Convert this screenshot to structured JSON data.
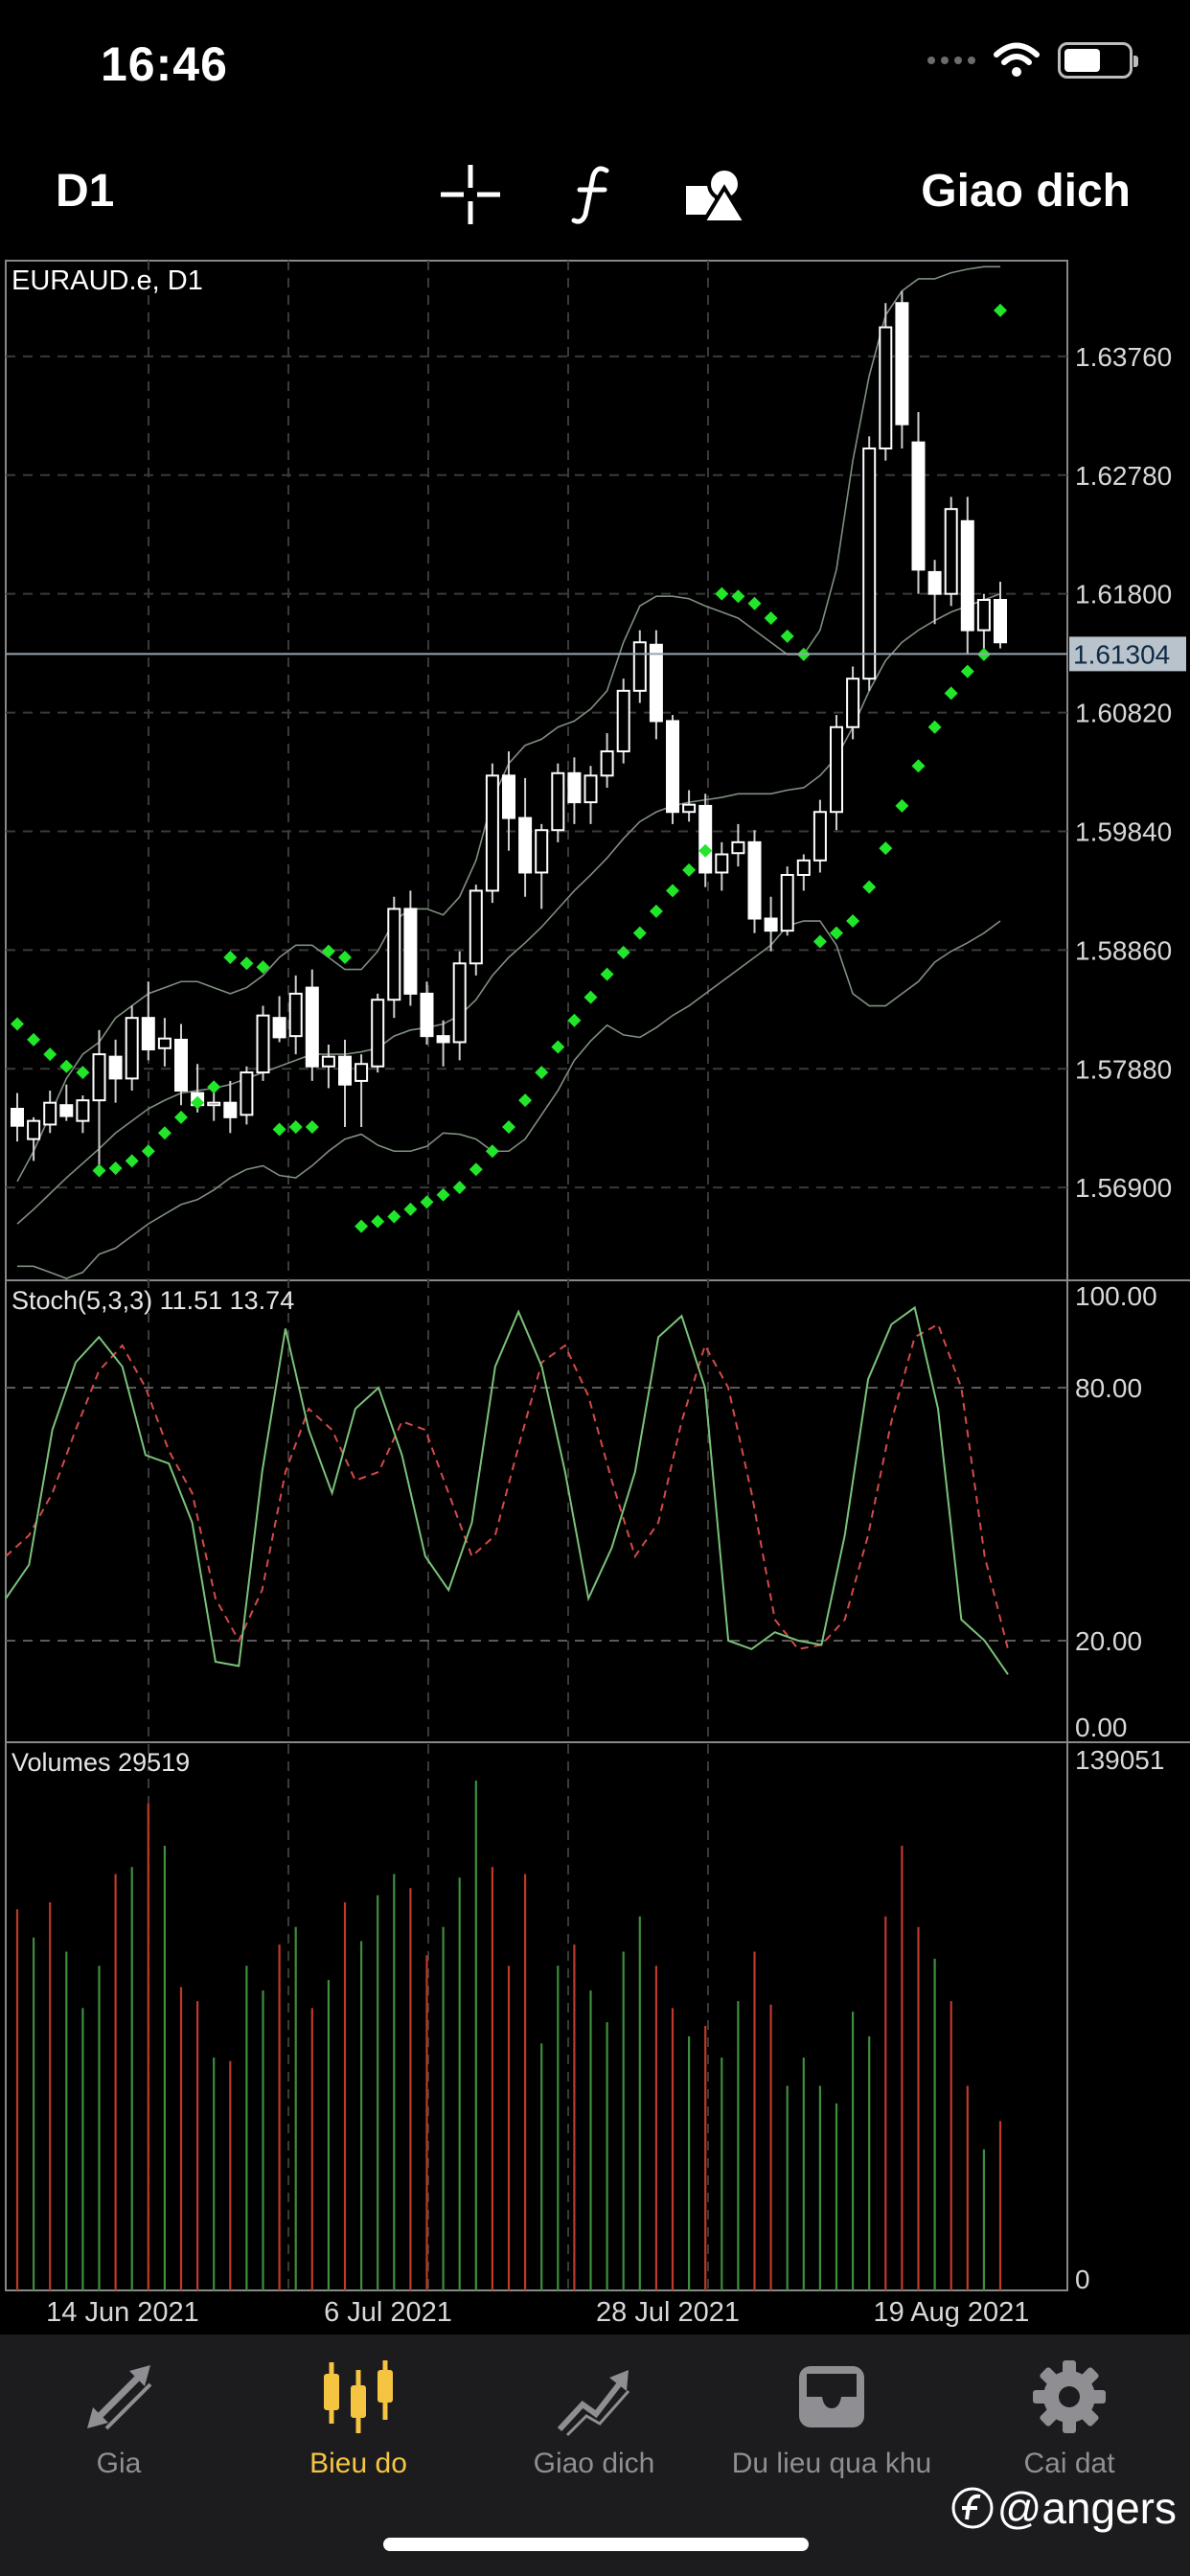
{
  "status_bar": {
    "time": "16:46"
  },
  "toolbar": {
    "timeframe": "D1",
    "crosshair_icon": "crosshair-icon",
    "indicator_icon": "function-icon",
    "objects_icon": "shapes-icon",
    "trade_label": "Giao dich"
  },
  "chart": {
    "symbol_label": "EURAUD.e, D1",
    "stoch_label": "Stoch(5,3,3) 11.51 13.74",
    "volumes_label": "Volumes 29519",
    "current_price": "1.61304",
    "price_ticks": [
      "1.63760",
      "1.62780",
      "1.61800",
      "1.60820",
      "1.59840",
      "1.58860",
      "1.57880",
      "1.56900"
    ],
    "stoch_ticks": [
      "100.00",
      "80.00",
      "20.00",
      "0.00"
    ],
    "volume_ticks": [
      "139051",
      "0"
    ],
    "date_ticks": [
      "14 Jun 2021",
      "6 Jul 2021",
      "28 Jul 2021",
      "19 Aug 2021"
    ],
    "colors": {
      "sar": "#22e62a",
      "stoch_main": "#7ac27a",
      "stoch_signal": "#d44a4a",
      "vol_up": "#3d8f3d",
      "vol_down": "#c0392b",
      "grid": "#3a3a3a"
    }
  },
  "chart_data": {
    "type": "candlestick",
    "symbol": "EURAUD.e",
    "timeframe": "D1",
    "price_range": [
      1.5615,
      1.6455
    ],
    "ohlc": [
      [
        1.5755,
        1.5768,
        1.5728,
        1.5741
      ],
      [
        1.573,
        1.5748,
        1.5712,
        1.5745
      ],
      [
        1.5742,
        1.577,
        1.5735,
        1.576
      ],
      [
        1.5758,
        1.5775,
        1.5745,
        1.5749
      ],
      [
        1.5745,
        1.5766,
        1.5735,
        1.5762
      ],
      [
        1.5762,
        1.582,
        1.5705,
        1.58
      ],
      [
        1.5798,
        1.5812,
        1.576,
        1.578
      ],
      [
        1.578,
        1.584,
        1.577,
        1.583
      ],
      [
        1.583,
        1.586,
        1.5795,
        1.5804
      ],
      [
        1.5805,
        1.583,
        1.579,
        1.5813
      ],
      [
        1.5812,
        1.5825,
        1.5758,
        1.577
      ],
      [
        1.5768,
        1.5792,
        1.5752,
        1.5758
      ],
      [
        1.5758,
        1.5775,
        1.5745,
        1.576
      ],
      [
        1.576,
        1.5778,
        1.5735,
        1.5748
      ],
      [
        1.575,
        1.579,
        1.5742,
        1.5785
      ],
      [
        1.5785,
        1.584,
        1.5778,
        1.5832
      ],
      [
        1.583,
        1.5848,
        1.581,
        1.5814
      ],
      [
        1.5815,
        1.5865,
        1.58,
        1.585
      ],
      [
        1.5855,
        1.587,
        1.5778,
        1.579
      ],
      [
        1.579,
        1.5808,
        1.5772,
        1.5798
      ],
      [
        1.5798,
        1.5812,
        1.574,
        1.5775
      ],
      [
        1.5778,
        1.58,
        1.574,
        1.5792
      ],
      [
        1.579,
        1.585,
        1.5785,
        1.5845
      ],
      [
        1.5845,
        1.593,
        1.583,
        1.592
      ],
      [
        1.592,
        1.5935,
        1.584,
        1.585
      ],
      [
        1.585,
        1.586,
        1.5808,
        1.5815
      ],
      [
        1.5815,
        1.5828,
        1.579,
        1.581
      ],
      [
        1.581,
        1.5885,
        1.5795,
        1.5875
      ],
      [
        1.5875,
        1.594,
        1.5865,
        1.5935
      ],
      [
        1.5935,
        1.604,
        1.5925,
        1.603
      ],
      [
        1.603,
        1.605,
        1.5968,
        1.5995
      ],
      [
        1.5995,
        1.6028,
        1.593,
        1.595
      ],
      [
        1.595,
        1.599,
        1.592,
        1.5985
      ],
      [
        1.5985,
        1.604,
        1.5975,
        1.6032
      ],
      [
        1.6032,
        1.6045,
        1.599,
        1.6008
      ],
      [
        1.6008,
        1.6038,
        1.599,
        1.603
      ],
      [
        1.603,
        1.6065,
        1.602,
        1.605
      ],
      [
        1.605,
        1.611,
        1.604,
        1.61
      ],
      [
        1.61,
        1.615,
        1.609,
        1.614
      ],
      [
        1.6138,
        1.615,
        1.606,
        1.6075
      ],
      [
        1.6075,
        1.608,
        1.599,
        1.6
      ],
      [
        1.6,
        1.6018,
        1.5992,
        1.6006
      ],
      [
        1.6005,
        1.6015,
        1.5938,
        1.595
      ],
      [
        1.595,
        1.5975,
        1.5935,
        1.5965
      ],
      [
        1.5966,
        1.599,
        1.5955,
        1.5975
      ],
      [
        1.5975,
        1.5985,
        1.59,
        1.5912
      ],
      [
        1.5912,
        1.593,
        1.5885,
        1.5902
      ],
      [
        1.5902,
        1.5955,
        1.5898,
        1.5948
      ],
      [
        1.5948,
        1.5965,
        1.5935,
        1.596
      ],
      [
        1.596,
        1.601,
        1.595,
        1.6
      ],
      [
        1.6,
        1.608,
        1.5985,
        1.607
      ],
      [
        1.607,
        1.612,
        1.606,
        1.611
      ],
      [
        1.611,
        1.631,
        1.61,
        1.63
      ],
      [
        1.63,
        1.642,
        1.629,
        1.64
      ],
      [
        1.642,
        1.643,
        1.63,
        1.632
      ],
      [
        1.6305,
        1.633,
        1.618,
        1.62
      ],
      [
        1.6198,
        1.6208,
        1.6155,
        1.618
      ],
      [
        1.618,
        1.626,
        1.617,
        1.625
      ],
      [
        1.624,
        1.626,
        1.613,
        1.615
      ],
      [
        1.615,
        1.618,
        1.6135,
        1.6175
      ],
      [
        1.6175,
        1.619,
        1.6135,
        1.614
      ]
    ],
    "bollinger": {
      "upper": [
        1.5695,
        1.572,
        1.575,
        1.578,
        1.58,
        1.581,
        1.583,
        1.584,
        1.585,
        1.5855,
        1.586,
        1.586,
        1.5855,
        1.585,
        1.5855,
        1.5865,
        1.588,
        1.589,
        1.589,
        1.588,
        1.587,
        1.587,
        1.5885,
        1.591,
        1.592,
        1.592,
        1.5915,
        1.593,
        1.596,
        1.601,
        1.604,
        1.6055,
        1.606,
        1.607,
        1.6075,
        1.6085,
        1.61,
        1.614,
        1.617,
        1.6178,
        1.6178,
        1.6176,
        1.617,
        1.6165,
        1.616,
        1.615,
        1.614,
        1.613,
        1.613,
        1.615,
        1.62,
        1.629,
        1.636,
        1.641,
        1.643,
        1.644,
        1.644,
        1.6445,
        1.6448,
        1.645,
        1.645
      ],
      "middle": [
        1.566,
        1.5672,
        1.5685,
        1.5698,
        1.571,
        1.5722,
        1.5735,
        1.5745,
        1.5755,
        1.5762,
        1.5768,
        1.577,
        1.5772,
        1.5775,
        1.578,
        1.5785,
        1.579,
        1.5795,
        1.58,
        1.58,
        1.58,
        1.5802,
        1.5805,
        1.5815,
        1.582,
        1.5822,
        1.5825,
        1.5832,
        1.5845,
        1.5865,
        1.588,
        1.5892,
        1.5905,
        1.592,
        1.5935,
        1.5948,
        1.5962,
        1.5978,
        1.5992,
        1.6,
        1.6005,
        1.6008,
        1.601,
        1.6012,
        1.6015,
        1.6015,
        1.6015,
        1.6018,
        1.602,
        1.603,
        1.6045,
        1.607,
        1.61,
        1.6125,
        1.614,
        1.615,
        1.6158,
        1.6165,
        1.617,
        1.6175,
        1.618
      ],
      "lower": [
        1.5625,
        1.5625,
        1.562,
        1.5615,
        1.562,
        1.5635,
        1.564,
        1.565,
        1.566,
        1.5668,
        1.5676,
        1.568,
        1.5688,
        1.5698,
        1.5705,
        1.5708,
        1.57,
        1.5698,
        1.5708,
        1.572,
        1.573,
        1.5734,
        1.5725,
        1.572,
        1.572,
        1.5724,
        1.5735,
        1.5734,
        1.573,
        1.572,
        1.572,
        1.573,
        1.575,
        1.577,
        1.5795,
        1.5811,
        1.5824,
        1.5816,
        1.5814,
        1.5822,
        1.5832,
        1.584,
        1.585,
        1.586,
        1.587,
        1.588,
        1.589,
        1.5906,
        1.591,
        1.591,
        1.589,
        1.585,
        1.584,
        1.584,
        1.585,
        1.586,
        1.5876,
        1.5885,
        1.5892,
        1.59,
        1.591
      ]
    },
    "parabolic_sar": [
      [
        0,
        1.5825
      ],
      [
        1,
        1.5812
      ],
      [
        2,
        1.58
      ],
      [
        3,
        1.579
      ],
      [
        4,
        1.5785
      ],
      [
        5,
        1.5704
      ],
      [
        6,
        1.5706
      ],
      [
        7,
        1.5712
      ],
      [
        8,
        1.572
      ],
      [
        9,
        1.5735
      ],
      [
        10,
        1.5748
      ],
      [
        11,
        1.576
      ],
      [
        12,
        1.5773
      ],
      [
        13,
        1.588
      ],
      [
        14,
        1.5875
      ],
      [
        15,
        1.5872
      ],
      [
        16,
        1.5738
      ],
      [
        17,
        1.574
      ],
      [
        18,
        1.574
      ],
      [
        19,
        1.5885
      ],
      [
        20,
        1.588
      ],
      [
        21,
        1.5658
      ],
      [
        22,
        1.5662
      ],
      [
        23,
        1.5666
      ],
      [
        24,
        1.5672
      ],
      [
        25,
        1.5678
      ],
      [
        26,
        1.5684
      ],
      [
        27,
        1.569
      ],
      [
        28,
        1.5705
      ],
      [
        29,
        1.572
      ],
      [
        30,
        1.574
      ],
      [
        31,
        1.5762
      ],
      [
        32,
        1.5785
      ],
      [
        33,
        1.5806
      ],
      [
        34,
        1.5828
      ],
      [
        35,
        1.5847
      ],
      [
        36,
        1.5866
      ],
      [
        37,
        1.5884
      ],
      [
        38,
        1.59
      ],
      [
        39,
        1.5918
      ],
      [
        40,
        1.5935
      ],
      [
        41,
        1.5952
      ],
      [
        42,
        1.5968
      ],
      [
        43,
        1.618
      ],
      [
        44,
        1.6178
      ],
      [
        45,
        1.6172
      ],
      [
        46,
        1.616
      ],
      [
        47,
        1.6145
      ],
      [
        48,
        1.613
      ],
      [
        49,
        1.5893
      ],
      [
        50,
        1.59
      ],
      [
        51,
        1.591
      ],
      [
        52,
        1.5938
      ],
      [
        53,
        1.597
      ],
      [
        54,
        1.6005
      ],
      [
        55,
        1.6038
      ],
      [
        56,
        1.607
      ],
      [
        57,
        1.6098
      ],
      [
        58,
        1.6116
      ],
      [
        59,
        1.613
      ],
      [
        60,
        1.6414
      ]
    ],
    "stochastic": {
      "label": "Stoch(5,3,3)",
      "main_value": 11.51,
      "signal_value": 13.74,
      "range": [
        0,
        100
      ],
      "levels": [
        20,
        80
      ],
      "main": [
        30,
        38,
        70,
        86,
        92,
        85,
        64,
        62,
        48,
        15,
        14,
        60,
        94,
        70,
        55,
        75,
        80,
        64,
        40,
        32,
        48,
        85,
        98,
        85,
        60,
        30,
        42,
        60,
        92,
        97,
        80,
        20,
        18,
        22,
        20,
        19,
        45,
        82,
        95,
        99,
        75,
        25,
        20,
        12
      ],
      "signal": [
        40,
        45,
        55,
        70,
        84,
        90,
        80,
        65,
        55,
        30,
        20,
        32,
        60,
        75,
        70,
        58,
        60,
        72,
        70,
        55,
        40,
        45,
        66,
        86,
        90,
        78,
        58,
        40,
        48,
        72,
        90,
        80,
        55,
        25,
        18,
        19,
        25,
        45,
        72,
        92,
        95,
        80,
        40,
        18
      ]
    },
    "volumes": {
      "label": "Volumes",
      "current": 29519,
      "max_tick": 139051,
      "values": [
        108000,
        100000,
        110000,
        96000,
        80000,
        92000,
        118000,
        120000,
        138000,
        126000,
        86000,
        82000,
        66000,
        65000,
        92000,
        85000,
        98000,
        103000,
        80000,
        88000,
        110000,
        99000,
        112000,
        118000,
        114000,
        95000,
        103000,
        117000,
        145000,
        120000,
        92000,
        118000,
        70000,
        92000,
        98000,
        85000,
        76000,
        96000,
        106000,
        92000,
        80000,
        72000,
        75000,
        66000,
        82000,
        96000,
        81000,
        58000,
        66000,
        58000,
        53000,
        79000,
        72000,
        106000,
        126000,
        103000,
        94000,
        82000,
        58000,
        40000,
        48000
      ],
      "direction": [
        "d",
        "u",
        "d",
        "u",
        "u",
        "u",
        "d",
        "u",
        "d",
        "u",
        "d",
        "d",
        "u",
        "d",
        "u",
        "u",
        "d",
        "u",
        "d",
        "u",
        "d",
        "u",
        "u",
        "u",
        "d",
        "d",
        "u",
        "u",
        "u",
        "d",
        "d",
        "d",
        "u",
        "u",
        "d",
        "u",
        "u",
        "u",
        "u",
        "d",
        "d",
        "u",
        "d",
        "u",
        "u",
        "d",
        "d",
        "u",
        "u",
        "u",
        "u",
        "u",
        "u",
        "d",
        "d",
        "d",
        "u",
        "d",
        "d",
        "u",
        "d"
      ]
    },
    "date_labels": [
      "14 Jun 2021",
      "6 Jul 2021",
      "28 Jul 2021",
      "19 Aug 2021"
    ],
    "current_price": 1.61304
  },
  "tabs": [
    {
      "label": "Gia",
      "icon": "arrows-icon"
    },
    {
      "label": "Bieu do",
      "icon": "candles-icon"
    },
    {
      "label": "Giao dich",
      "icon": "trend-icon"
    },
    {
      "label": "Du lieu qua khu",
      "icon": "inbox-icon"
    },
    {
      "label": "Cai dat",
      "icon": "gear-icon"
    }
  ],
  "watermark": {
    "text": "@angers",
    "icon": "logo-icon"
  }
}
